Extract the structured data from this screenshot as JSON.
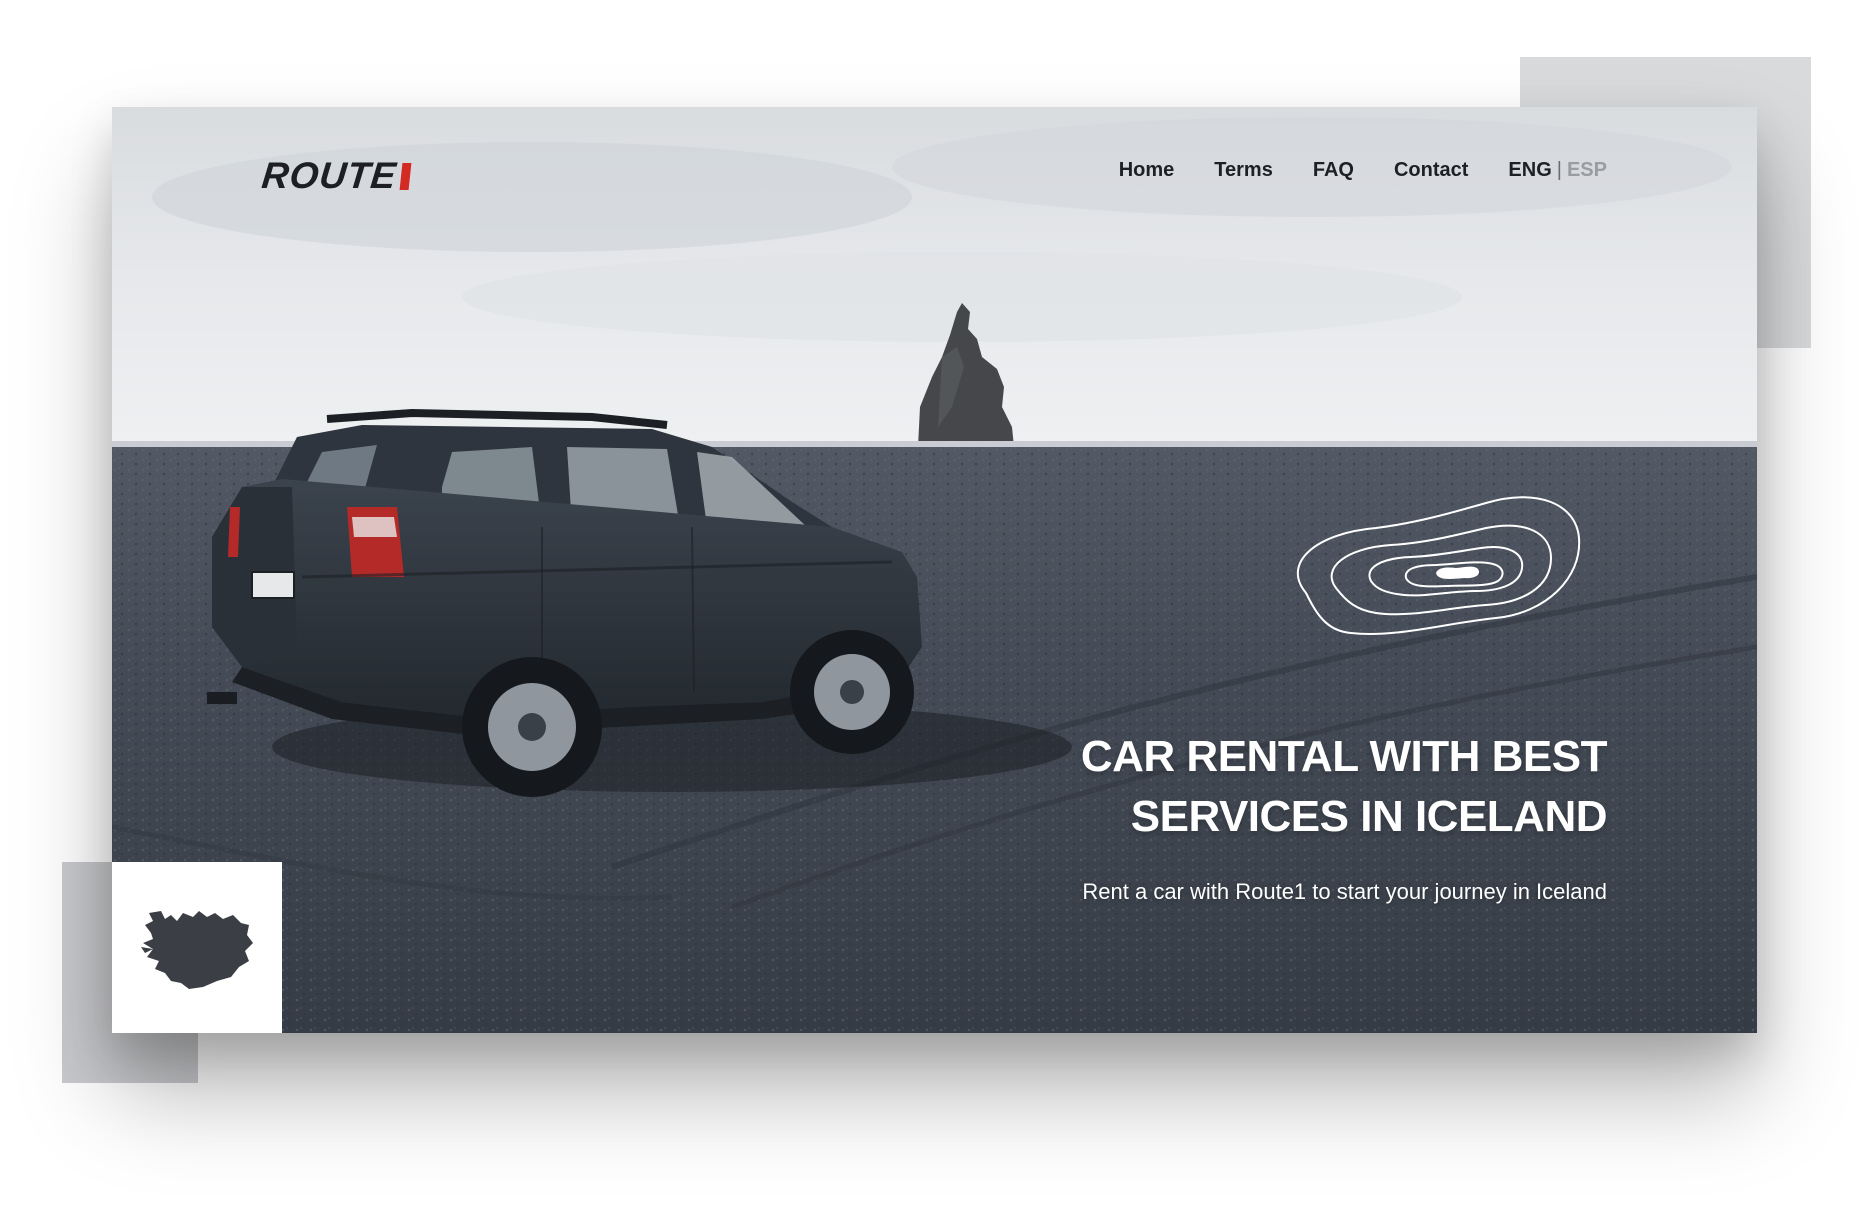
{
  "brand": {
    "name": "ROUTE",
    "accent_color": "#d32a24"
  },
  "nav": {
    "items": [
      {
        "label": "Home"
      },
      {
        "label": "Terms"
      },
      {
        "label": "FAQ"
      },
      {
        "label": "Contact"
      }
    ],
    "language": {
      "active": "ENG",
      "separator": "|",
      "inactive": "ESP"
    }
  },
  "hero": {
    "headline_line1": "CAR RENTAL WITH BEST",
    "headline_line2": "SERVICES IN ICELAND",
    "subline": "Rent a car with Route1 to start your journey in Iceland"
  },
  "icons": {
    "topo": "topographic-lines-icon",
    "map": "iceland-map-icon"
  },
  "colors": {
    "text_dark": "#1e2024",
    "text_light": "#ffffff",
    "sky": "#e4e6ea",
    "ground": "#3d444e"
  }
}
